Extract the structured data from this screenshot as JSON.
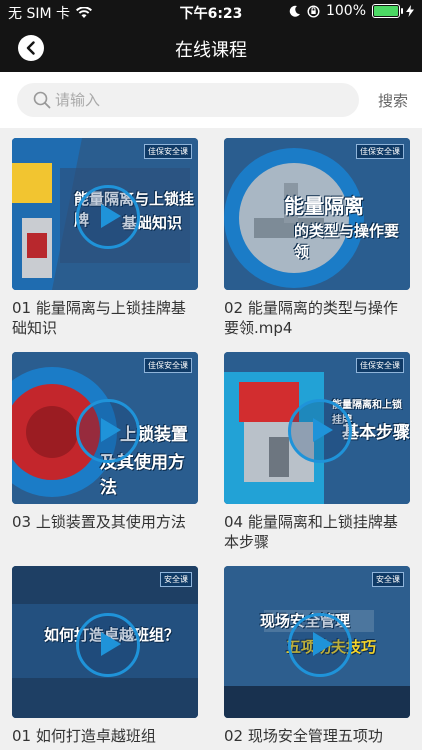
{
  "status_bar": {
    "carrier": "无 SIM 卡",
    "time": "下午6:23",
    "battery": "100%",
    "battery_level": 1.0
  },
  "nav": {
    "title": "在线课程",
    "back_icon": "chevron-left-icon"
  },
  "search": {
    "placeholder": "请输入",
    "value": "",
    "button_label": "搜索",
    "icon": "search-icon"
  },
  "courses": [
    {
      "title": "01 能量隔离与上锁挂牌基础知识",
      "thumb_text": [
        "能量隔离与上锁挂牌",
        "基础知识"
      ],
      "logo": "佳保安全课"
    },
    {
      "title": "02 能量隔离的类型与操作要领.mp4",
      "thumb_text": [
        "能量隔离",
        "的类型与操作要领"
      ],
      "logo": "佳保安全课"
    },
    {
      "title": "03 上锁装置及其使用方法",
      "thumb_text": [
        "上锁装置",
        "及其使用方法"
      ],
      "logo": "佳保安全课"
    },
    {
      "title": "04 能量隔离和上锁挂牌基本步骤",
      "thumb_text": [
        "能量隔离和上锁挂牌",
        "基本步骤"
      ],
      "logo": "佳保安全课"
    },
    {
      "title": "01 如何打造卓越班组",
      "thumb_text": [
        "如何打造卓越班组？"
      ],
      "logo": "安全课"
    },
    {
      "title": "02 现场安全管理五项功",
      "thumb_text": [
        "现场安全管理",
        "五项功夫技巧"
      ],
      "logo": "安全课"
    }
  ],
  "colors": {
    "header_bg": "#141414",
    "accent_blue": "#1f93d9",
    "thumb_bg": "#1d4d7f"
  }
}
